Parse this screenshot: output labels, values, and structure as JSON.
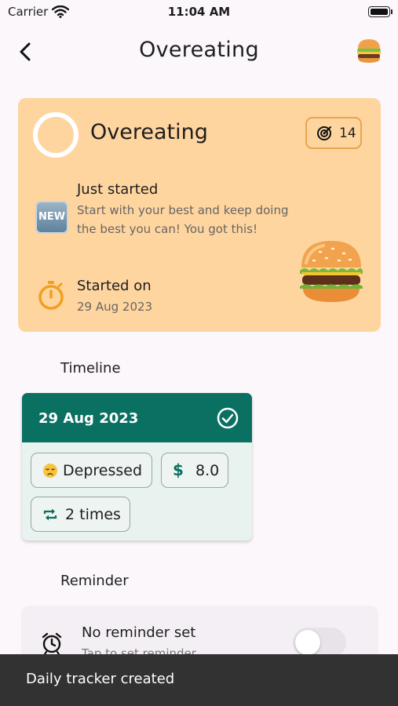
{
  "status_bar": {
    "carrier": "Carrier",
    "time": "11:04 AM"
  },
  "header": {
    "title": "Overeating",
    "icon": "hamburger-emoji"
  },
  "habit_card": {
    "title": "Overeating",
    "streak_count": "14",
    "progress_section": {
      "badge": "NEW",
      "title": "Just started",
      "description": "Start with your best and keep doing the best you can! You got this!"
    },
    "start_section": {
      "title": "Started on",
      "date": "29 Aug 2023"
    },
    "background_color": "#ffd59f"
  },
  "timeline": {
    "label": "Timeline",
    "entries": [
      {
        "date": "29 Aug 2023",
        "mood": {
          "emoji": "😞",
          "label": "Depressed"
        },
        "cost": {
          "symbol": "$",
          "value": "8.0"
        },
        "times": "2 times"
      }
    ],
    "header_color": "#0a7062"
  },
  "reminder": {
    "label": "Reminder",
    "title": "No reminder set",
    "subtitle": "Tap to set reminder",
    "enabled": false
  },
  "snackbar": {
    "message": "Daily tracker created"
  }
}
